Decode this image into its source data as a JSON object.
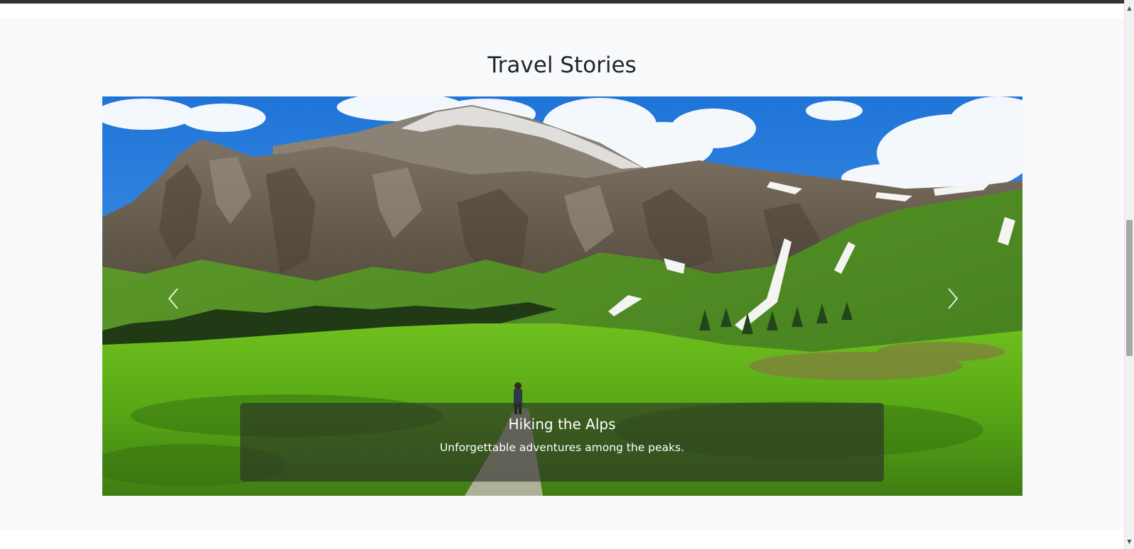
{
  "section": {
    "title": "Travel Stories"
  },
  "carousel": {
    "slide": {
      "image_alt": "Hikers on a trail through green alpine meadows below rocky mountains",
      "caption_title": "Hiking the Alps",
      "caption_text": "Unforgettable adventures among the peaks."
    },
    "prev_icon": "chevron-left-icon",
    "next_icon": "chevron-right-icon"
  },
  "colors": {
    "section_bg": "#f8f9fa",
    "title_text": "#212529",
    "caption_bg": "rgba(40,40,40,0.58)",
    "caption_text": "#ffffff"
  },
  "scrollbar": {
    "up_icon": "triangle-up-icon",
    "down_icon": "triangle-down-icon",
    "up_glyph": "▲",
    "down_glyph": "▼"
  }
}
